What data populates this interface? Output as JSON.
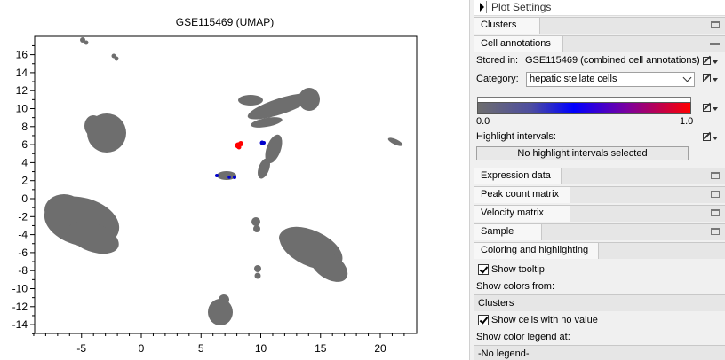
{
  "plot": {
    "title": "GSE115469 (UMAP)",
    "x_ticks": [
      "-5",
      "0",
      "5",
      "10",
      "15",
      "20"
    ],
    "y_ticks": [
      "16",
      "14",
      "12",
      "10",
      "8",
      "6",
      "4",
      "2",
      "0",
      "-2",
      "-4",
      "-6",
      "-8",
      "-10",
      "-12",
      "-14"
    ],
    "colors": {
      "base": "#6e6e6e",
      "low": "#0000cc",
      "high": "#ff0000"
    }
  },
  "panel": {
    "header": "Plot Settings",
    "sections": {
      "clusters": "Clusters",
      "cell_annotations": "Cell annotations",
      "expression_data": "Expression data",
      "peak_count_matrix": "Peak count matrix",
      "velocity_matrix": "Velocity matrix",
      "sample": "Sample",
      "coloring": "Coloring and highlighting"
    },
    "stored_in_label": "Stored in:",
    "stored_in_value": "GSE115469 (combined cell annotations)",
    "category_label": "Category:",
    "category_value": "hepatic stellate cells",
    "gradient_min": "0.0",
    "gradient_max": "1.0",
    "highlight_label": "Highlight intervals:",
    "highlight_button": "No highlight intervals selected",
    "show_tooltip": "Show tooltip",
    "show_colors_from": "Show colors from:",
    "colors_from_value": "Clusters",
    "show_cells_no_value": "Show cells with no value",
    "show_legend_at": "Show color legend at:",
    "legend_value": "-No legend-"
  }
}
